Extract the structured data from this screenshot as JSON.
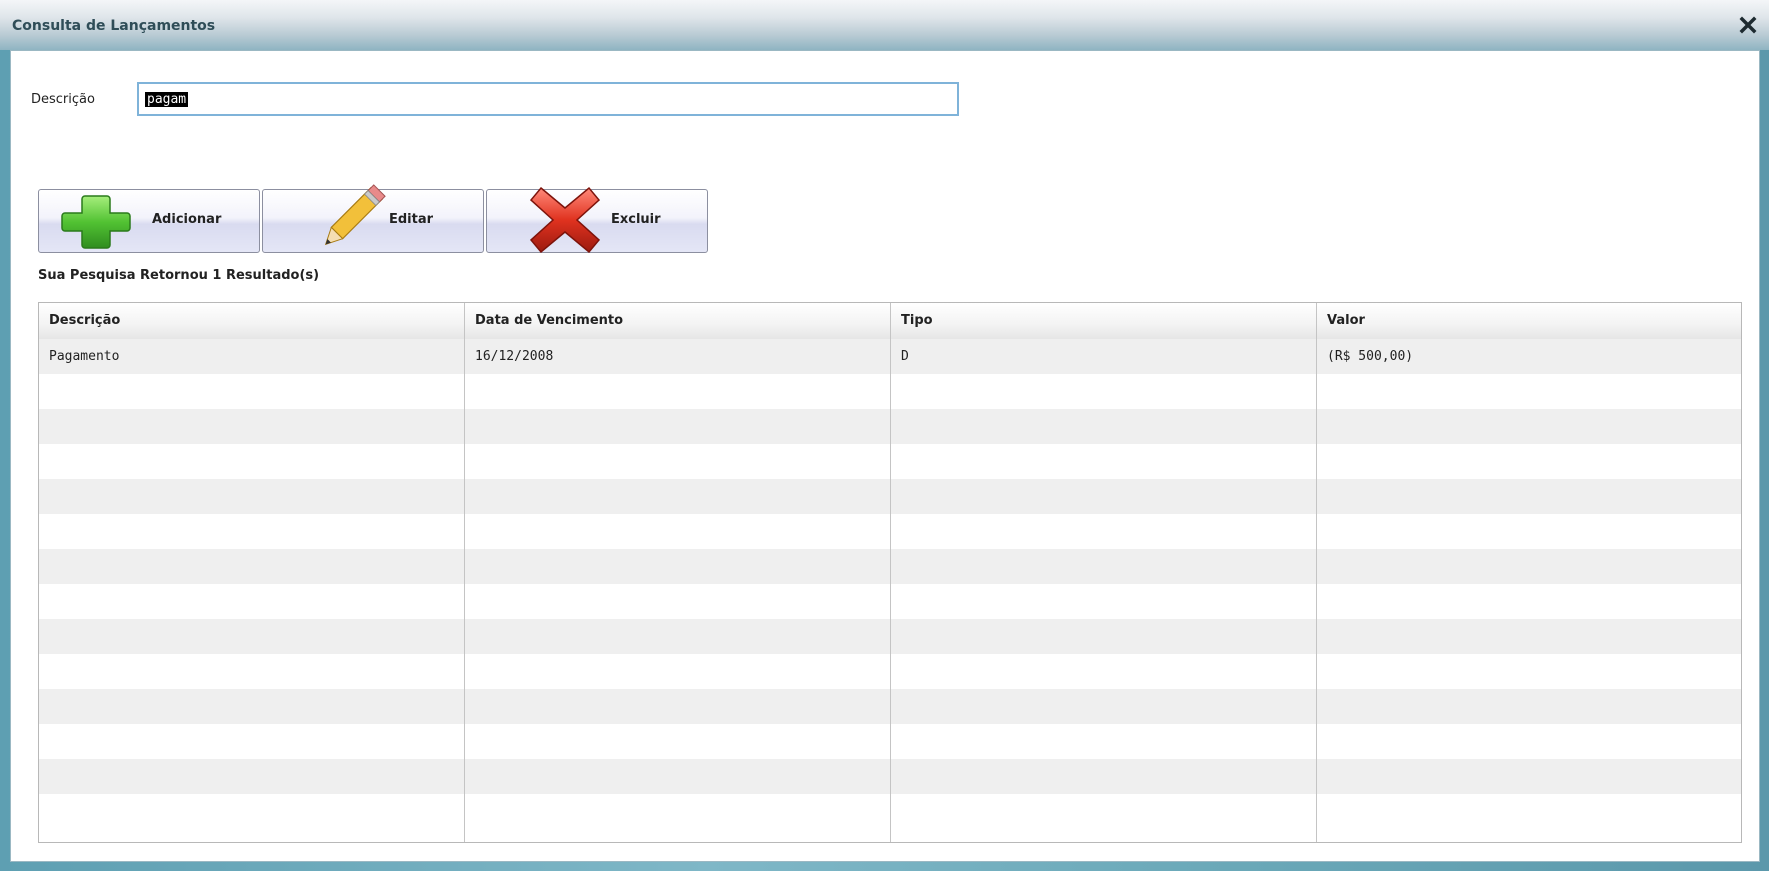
{
  "window": {
    "title": "Consulta de Lançamentos",
    "close_icon": "close-icon"
  },
  "search": {
    "label": "Descrição",
    "value": "pagam"
  },
  "toolbar": {
    "add_label": "Adicionar",
    "edit_label": "Editar",
    "delete_label": "Excluir",
    "add_icon": "plus-icon",
    "edit_icon": "pencil-icon",
    "delete_icon": "x-icon"
  },
  "results": {
    "message": "Sua Pesquisa Retornou 1 Resultado(s)"
  },
  "table": {
    "columns": [
      "Descrição",
      "Data de Vencimento",
      "Tipo",
      "Valor"
    ],
    "rows": [
      [
        "Pagamento",
        "16/12/2008",
        "D",
        "(R$ 500,00)"
      ]
    ]
  },
  "colors": {
    "title_text": "#2f4d58",
    "add_green": "#4caf2e",
    "delete_red": "#d42b1f",
    "input_border": "#7fb3d9"
  }
}
